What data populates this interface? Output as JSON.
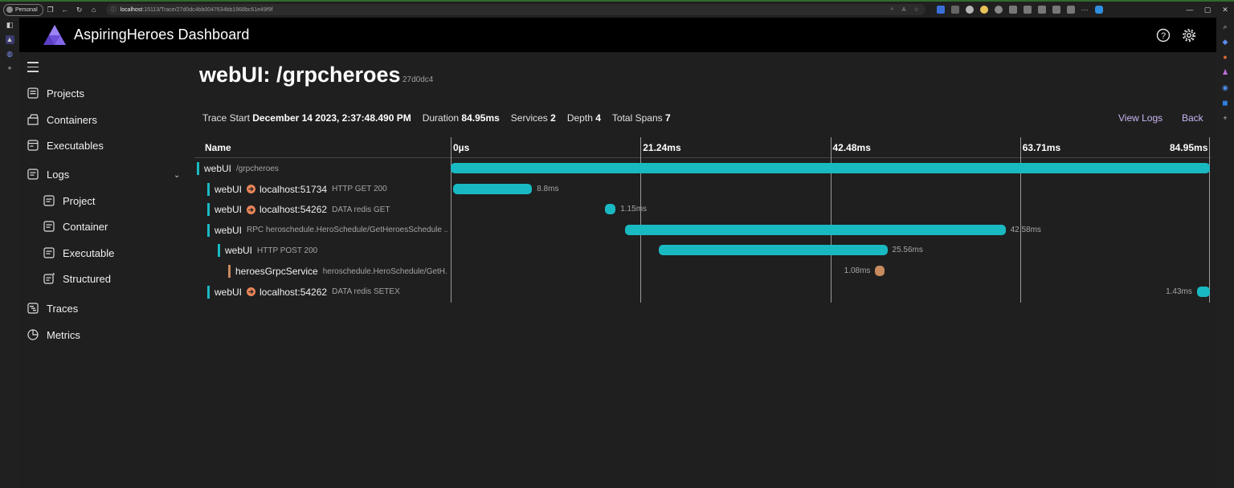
{
  "browser": {
    "profile": "Personal",
    "url_host": "localhost",
    "url_rest": ":15113/Trace/27d0dc4bb0047634bb1968bc61e49f9f"
  },
  "app": {
    "title": "AspiringHeroes Dashboard",
    "logo_color": "#8c6cf2",
    "help_icon": "question-circle-icon",
    "settings_icon": "gear-icon"
  },
  "nav": {
    "items": [
      {
        "label": "Projects",
        "icon": "projects-icon"
      },
      {
        "label": "Containers",
        "icon": "containers-icon"
      },
      {
        "label": "Executables",
        "icon": "executables-icon"
      },
      {
        "label": "Logs",
        "icon": "logs-icon",
        "expanded": true
      },
      {
        "label": "Project",
        "icon": "project-log-icon"
      },
      {
        "label": "Container",
        "icon": "container-log-icon"
      },
      {
        "label": "Executable",
        "icon": "executable-log-icon"
      },
      {
        "label": "Structured",
        "icon": "structured-log-icon"
      },
      {
        "label": "Traces",
        "icon": "traces-icon"
      },
      {
        "label": "Metrics",
        "icon": "metrics-icon"
      }
    ]
  },
  "trace": {
    "title": "webUI: /grpcheroes",
    "id": "27d0dc4",
    "summary": {
      "start_label": "Trace Start",
      "start_value": "December 14 2023, 2:37:48.490 PM",
      "duration_label": "Duration",
      "duration_value": "84.95ms",
      "services_label": "Services",
      "services_value": "2",
      "depth_label": "Depth",
      "depth_value": "4",
      "spans_label": "Total Spans",
      "spans_value": "7"
    },
    "view_logs": "View Logs",
    "back": "Back",
    "name_header": "Name",
    "ticks": [
      "0µs",
      "21.24ms",
      "42.48ms",
      "63.71ms",
      "84.95ms"
    ],
    "total_ms": 84.95,
    "colors": {
      "webUI": "#19b9c2",
      "heroesGrpcService": "#c78a5e"
    },
    "spans": [
      {
        "service": "webUI",
        "dest": "",
        "op": "/grpcheroes",
        "depth": 0,
        "start_ms": 0,
        "dur_ms": 84.95,
        "dur_label": ""
      },
      {
        "service": "webUI",
        "dest": "localhost:51734",
        "op": "HTTP GET 200",
        "depth": 1,
        "start_ms": 0.3,
        "dur_ms": 8.8,
        "dur_label": "8.8ms"
      },
      {
        "service": "webUI",
        "dest": "localhost:54262",
        "op": "DATA redis GET",
        "depth": 1,
        "start_ms": 17.3,
        "dur_ms": 1.15,
        "dur_label": "1.15ms"
      },
      {
        "service": "webUI",
        "dest": "",
        "op": "RPC heroschedule.HeroSchedule/GetHeroesSchedule ...",
        "depth": 1,
        "start_ms": 19.5,
        "dur_ms": 42.58,
        "dur_label": "42.58ms"
      },
      {
        "service": "webUI",
        "dest": "",
        "op": "HTTP POST 200",
        "depth": 2,
        "start_ms": 23.3,
        "dur_ms": 25.56,
        "dur_label": "25.56ms"
      },
      {
        "service": "heroesGrpcService",
        "dest": "",
        "op": "heroschedule.HeroSchedule/GetH...",
        "depth": 3,
        "start_ms": 47.5,
        "dur_ms": 1.08,
        "dur_label": "1.08ms"
      },
      {
        "service": "webUI",
        "dest": "localhost:54262",
        "op": "DATA redis SETEX",
        "depth": 1,
        "start_ms": 83.5,
        "dur_ms": 1.43,
        "dur_label": "1.43ms"
      }
    ]
  }
}
